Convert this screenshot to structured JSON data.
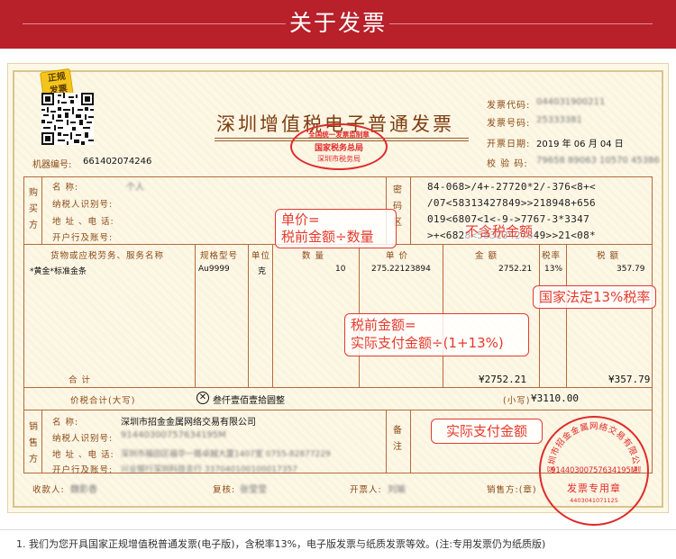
{
  "header": {
    "title": "关于发票"
  },
  "badge": {
    "text_line1": "正规",
    "text_line2": "发票"
  },
  "invoice": {
    "title": "深圳增值税电子普通发票",
    "machine_no_label": "机器编号:",
    "machine_no": "661402074246",
    "right_fields": [
      {
        "label": "发票代码:",
        "value": "044031900211"
      },
      {
        "label": "发票号码:",
        "value": "25333381"
      },
      {
        "label": "开票日期:",
        "value": "2019 年 06 月 04 日"
      },
      {
        "label": "校  验  码:",
        "value": "79658 89063 10570 45386"
      }
    ],
    "buyer": {
      "section_label": "购买方",
      "name_label": "名       称:",
      "name_value": "个人",
      "tax_id_label": "纳税人识别号:",
      "addr_label": "地 址 、电 话:",
      "bank_label": "开户行及账号:"
    },
    "cipher_label": "密码区",
    "cipher_lines": [
      "84-068>/4+-27720*2/-376<8+<",
      "/07<58313427849>>218948+656",
      "019<6807<1<-9->7767-3*3347",
      ">+<6828<58313427849>>21<08*"
    ],
    "columns": {
      "item": "货物或应税劳务、服务名称",
      "spec": "规格型号",
      "unit": "单位",
      "qty": "数   量",
      "price": "单   价",
      "amount": "金   额",
      "rate": "税率",
      "tax": "税   额"
    },
    "row": {
      "item": "*黄金*标准金条",
      "spec": "Au9999",
      "unit": "克",
      "qty": "10",
      "price": "275.22123894",
      "amount": "2752.21",
      "rate": "13%",
      "tax": "357.79"
    },
    "total_label": "合         计",
    "total_amount": "¥2752.21",
    "total_tax": "¥357.79",
    "grand_label": "价税合计(大写)",
    "grand_words": "叁仟壹佰壹拾圆整",
    "grand_small_label": "(小写)",
    "grand_value": "¥3110.00",
    "seller": {
      "section_label": "销售方",
      "name_label": "名       称:",
      "name_value": "深圳市招金金属网络交易有限公司",
      "tax_id_label": "纳税人识别号:",
      "tax_id_value": "91440300757634195M",
      "addr_label": "地 址 、电 话:",
      "addr_value": "深圳市福田区福华一路卓越大厦1407室 0755-82877229",
      "bank_label": "开户行及账号:",
      "bank_value": "兴业银行深圳科技支行 337040100100017357"
    },
    "remark_label": "备注",
    "footer": {
      "payee_label": "收款人:",
      "payee": "魏影香",
      "reviewer_label": "复核:",
      "reviewer": "张莹莹",
      "issuer_label": "开票人:",
      "issuer": "刘瑜",
      "seller_stamp_label": "销售方:(章)"
    },
    "tax_stamp": {
      "top": "全国统一发票监制章",
      "mid": "国家税务总局",
      "bottom": "深圳市税务局"
    },
    "seller_stamp": {
      "arc": "深圳市招金金属网络交易有限公司",
      "tax_id": "91440300757634195M",
      "bottom": "发票专用章",
      "serial": "4403041071125"
    }
  },
  "annotations": {
    "unit_price_line1": "单价=",
    "unit_price_line2": "税前金额÷数量",
    "pretax_note": "不含税金额",
    "tax_rate_note": "国家法定13%税率",
    "pretax_formula_line1": "税前金额=",
    "pretax_formula_line2": "实际支付金额÷(1+13%)",
    "actual_paid": "实际支付金额"
  },
  "note": "1. 我们为您开具国家正规增值税普通发票(电子版)，含税率13%，电子版发票与纸质发票等效。(注:专用发票仍为纸质版)",
  "colors": {
    "header_red": "#b8202a",
    "annotation_red": "#e53a2c",
    "stamp_red": "#e02a2a",
    "label_brown": "#8a4a16"
  }
}
